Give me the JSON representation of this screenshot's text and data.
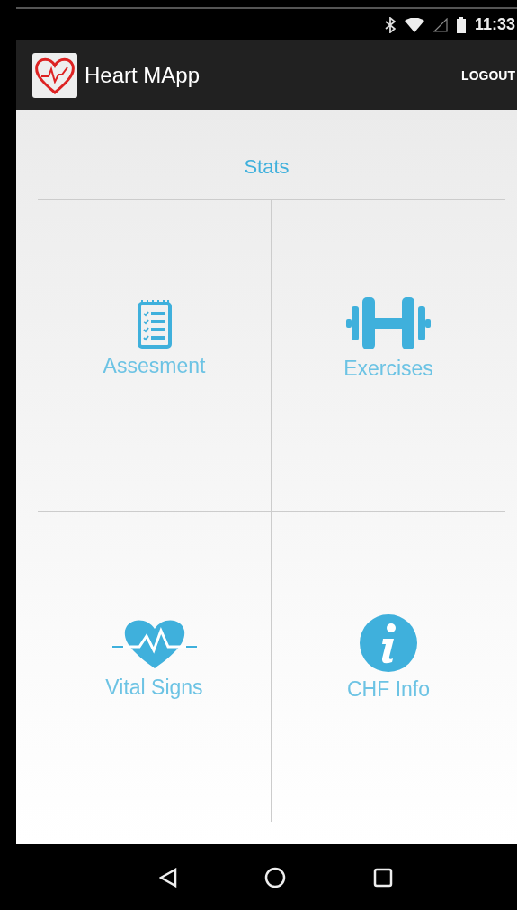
{
  "status_bar": {
    "time": "11:33"
  },
  "app_bar": {
    "title": "Heart MApp",
    "action": "LOGOUT"
  },
  "header": {
    "title": "Stats"
  },
  "tiles": [
    {
      "kind": "clipboard",
      "label": "Assesment"
    },
    {
      "kind": "dumbbell",
      "label": "Exercises"
    },
    {
      "kind": "heart",
      "label": "Vital Signs"
    },
    {
      "kind": "info",
      "label": "CHF Info"
    }
  ]
}
